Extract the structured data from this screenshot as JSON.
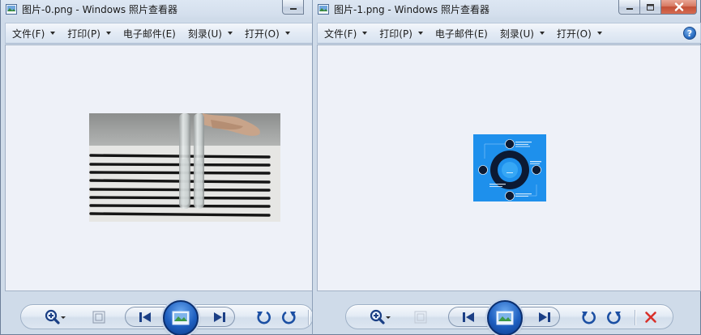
{
  "windows": [
    {
      "title": "图片-0.png - Windows 照片查看器",
      "menu": [
        {
          "label": "文件(F)",
          "has_arrow": true
        },
        {
          "label": "打印(P)",
          "has_arrow": true
        },
        {
          "label": "电子邮件(E)",
          "has_arrow": false
        },
        {
          "label": "刻录(U)",
          "has_arrow": true
        },
        {
          "label": "打开(O)",
          "has_arrow": true
        }
      ],
      "image_content": "test tubes on striped background"
    },
    {
      "title": "图片-1.png - Windows 照片查看器",
      "menu": [
        {
          "label": "文件(F)",
          "has_arrow": true
        },
        {
          "label": "打印(P)",
          "has_arrow": true
        },
        {
          "label": "电子邮件(E)",
          "has_arrow": false
        },
        {
          "label": "刻录(U)",
          "has_arrow": true
        },
        {
          "label": "打开(O)",
          "has_arrow": true
        }
      ],
      "help_label": "?",
      "image_content": "blue circular infographic"
    }
  ],
  "icons": {
    "zoom": "zoom-icon",
    "actual_size": "actual-size-icon",
    "previous": "previous-icon",
    "slideshow": "slideshow-icon",
    "next": "next-icon",
    "rotate_left": "rotate-counterclockwise-icon",
    "rotate_right": "rotate-clockwise-icon",
    "delete": "delete-icon"
  },
  "colors": {
    "accent_blue": "#1e5fc0",
    "delete_red": "#d9302a",
    "viewer_bg": "#eef1f8"
  }
}
